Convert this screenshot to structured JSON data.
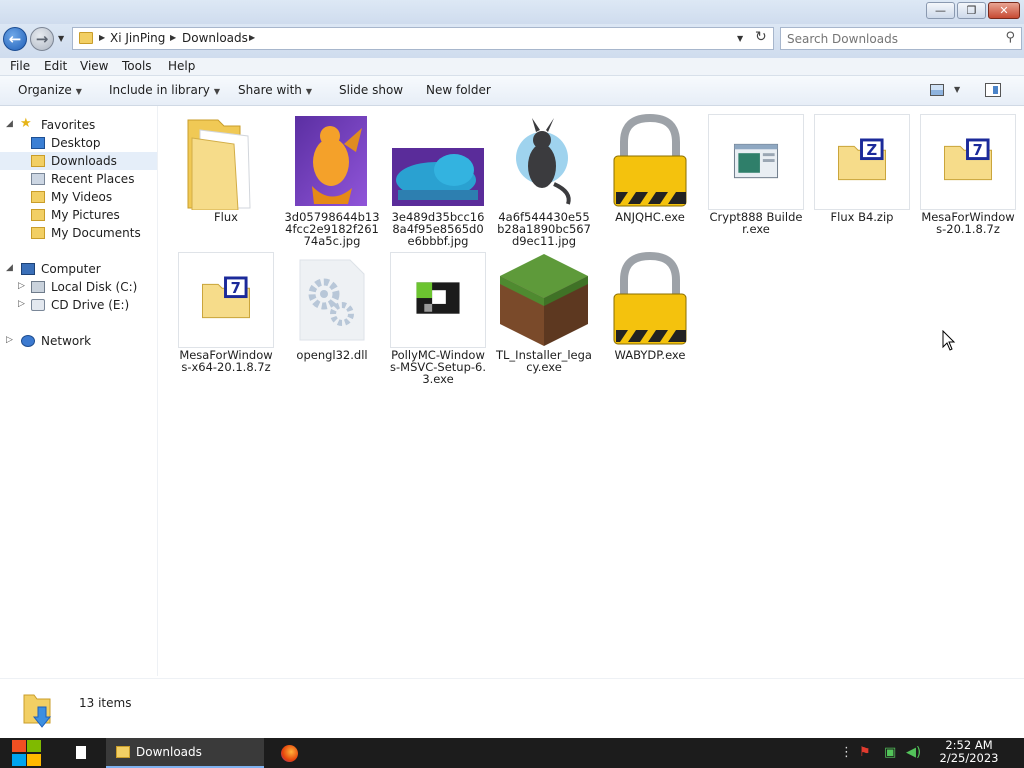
{
  "window": {
    "controls": {
      "minimize": "—",
      "restore": "❐",
      "close": "✕"
    }
  },
  "address": {
    "crumbs": [
      "Xi JinPing",
      "Downloads"
    ],
    "search_placeholder": "Search Downloads"
  },
  "menubar": [
    "File",
    "Edit",
    "View",
    "Tools",
    "Help"
  ],
  "toolbar": {
    "organize": "Organize",
    "include_in_library": "Include in library",
    "share_with": "Share with",
    "slide_show": "Slide show",
    "new_folder": "New folder"
  },
  "navpane": {
    "favorites": "Favorites",
    "favorite_items": [
      "Desktop",
      "Downloads",
      "Recent Places",
      "My Videos",
      "My Pictures",
      "My Documents"
    ],
    "selected": "Downloads",
    "computer": "Computer",
    "computer_items": [
      "Local Disk (C:)",
      "CD Drive (E:)"
    ],
    "network": "Network"
  },
  "files": [
    {
      "name": "Flux",
      "icon": "folder-icon"
    },
    {
      "name": "3d05798644b134fcc2e9182f26174a5c.jpg",
      "icon": "image-thumbnail-dragon"
    },
    {
      "name": "3e489d35bcc168a4f95e8565d0e6bbbf.jpg",
      "icon": "image-thumbnail-blue"
    },
    {
      "name": "4a6f544430e55b28a1890bc567d9ec11.jpg",
      "icon": "image-thumbnail-gray"
    },
    {
      "name": "ANJQHC.exe",
      "icon": "padlock-icon"
    },
    {
      "name": "Crypt888 Builder.exe",
      "icon": "app-window-icon"
    },
    {
      "name": "Flux B4.zip",
      "icon": "zip-archive-icon"
    },
    {
      "name": "MesaForWindows-20.1.8.7z",
      "icon": "7z-archive-icon"
    },
    {
      "name": "MesaForWindows-x64-20.1.8.7z",
      "icon": "7z-archive-icon"
    },
    {
      "name": "opengl32.dll",
      "icon": "gear-file-icon"
    },
    {
      "name": "PollyMC-Windows-MSVC-Setup-6.3.exe",
      "icon": "pollymc-icon"
    },
    {
      "name": "TL_Installer_legacy.exe",
      "icon": "grass-block-icon"
    },
    {
      "name": "WABYDP.exe",
      "icon": "padlock-icon"
    }
  ],
  "status": {
    "count": "13 items"
  },
  "taskbar": {
    "task_label": "Downloads",
    "time": "2:52 AM",
    "date": "2/25/2023"
  },
  "colors": {
    "selection": "#e5eef9",
    "taskbar": "#1c1c1c",
    "folder": "#f2cf64",
    "lock_yellow": "#f4c20d"
  }
}
